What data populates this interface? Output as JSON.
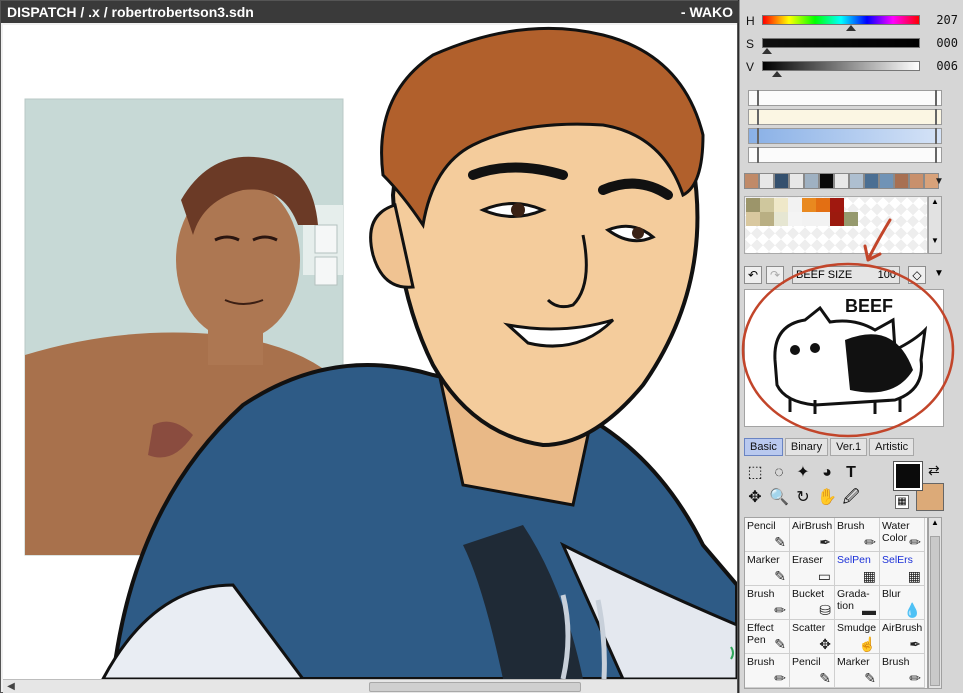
{
  "canvas": {
    "title": "DISPATCH  / .x  / robertrobertson3.sdn",
    "title_right": "- WAKO"
  },
  "hsv": {
    "h_label": "H",
    "h_value": "207",
    "s_label": "S",
    "s_value": "000",
    "v_label": "V",
    "v_value": "006"
  },
  "brush": {
    "name": "BEEF SIZE",
    "size": "100",
    "preview_text": "BEEF"
  },
  "tabs": [
    "Basic",
    "Binary",
    "Ver.1",
    "Artistic"
  ],
  "brushes": [
    {
      "label": "Pencil",
      "icon": "✎",
      "blue": false
    },
    {
      "label": "AirBrush",
      "icon": "✒",
      "blue": false
    },
    {
      "label": "Brush",
      "icon": "✏",
      "blue": false
    },
    {
      "label": "Water Color",
      "icon": "✏",
      "blue": false
    },
    {
      "label": "Marker",
      "icon": "✎",
      "blue": false
    },
    {
      "label": "Eraser",
      "icon": "▭",
      "blue": false
    },
    {
      "label": "SelPen",
      "icon": "▦",
      "blue": true
    },
    {
      "label": "SelErs",
      "icon": "▦",
      "blue": true
    },
    {
      "label": "Brush",
      "icon": "✏",
      "blue": false
    },
    {
      "label": "Bucket",
      "icon": "⛁",
      "blue": false
    },
    {
      "label": "Grada- tion",
      "icon": "▬",
      "blue": false
    },
    {
      "label": "Blur",
      "icon": "💧",
      "blue": false
    },
    {
      "label": "Effect Pen",
      "icon": "✎",
      "blue": false
    },
    {
      "label": "Scatter",
      "icon": "✥",
      "blue": false
    },
    {
      "label": "Smudge",
      "icon": "☝",
      "blue": false
    },
    {
      "label": "AirBrush",
      "icon": "✒",
      "blue": false
    },
    {
      "label": "Brush",
      "icon": "✏",
      "blue": false
    },
    {
      "label": "Pencil",
      "icon": "✎",
      "blue": false
    },
    {
      "label": "Marker",
      "icon": "✎",
      "blue": false
    },
    {
      "label": "Brush",
      "icon": "✏",
      "blue": false
    }
  ],
  "colors": {
    "foreground": "#0b0b0b",
    "background": "#dcaa78",
    "palette_row": [
      "#c08a68",
      "#e8e8e8",
      "#34506e",
      "#e8e8e8",
      "#9fb1c2",
      "#0a0a0a",
      "#e8e8e8",
      "#aebfd0",
      "#4b6f93",
      "#7093b6",
      "#a87052",
      "#c8906c",
      "#d8a27a"
    ],
    "palette_grid": [
      "#9c956a",
      "#cfc79d",
      "#efe8c9",
      "#f2f2f2",
      "#e9891f",
      "#e36f13",
      "#a0180f",
      "#d9c89f",
      "#b9af83",
      "#e6e6d2",
      "#f4f4f4",
      "#f2f2f2",
      "#f2f2f2",
      "#9c1a0e",
      "#969a6e"
    ]
  }
}
